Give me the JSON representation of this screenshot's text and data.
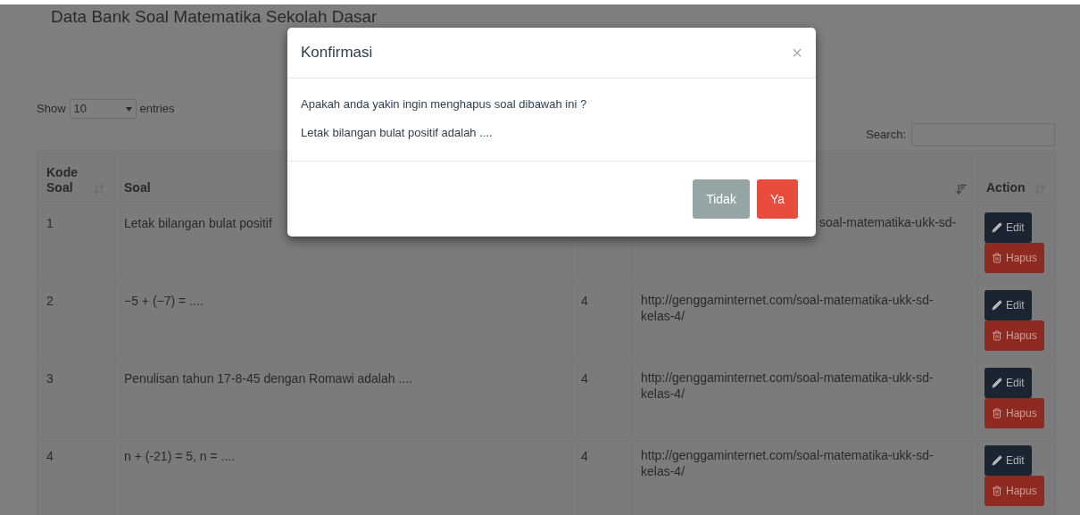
{
  "page_title": "Data Bank Soal Matematika Sekolah Dasar",
  "length_control": {
    "label_before": "Show",
    "value": "10",
    "label_after": "entries"
  },
  "search": {
    "label": "Search:"
  },
  "table": {
    "columns": [
      {
        "label": "Kode Soal",
        "sortable": true,
        "sorted": false
      },
      {
        "label": "Soal"
      },
      {},
      {
        "sortable": true,
        "sorted": true
      },
      {
        "label": "Action",
        "sortable": true,
        "sorted": false
      }
    ],
    "rows": [
      {
        "kode": "1",
        "soal": "Letak bilangan bulat positif",
        "column_4": "soal-matematika-ukk-sd-",
        "covered": true,
        "actions": [
          {
            "kind": "edit",
            "label": "Edit"
          },
          {
            "kind": "delete",
            "label": "Hapus"
          }
        ]
      },
      {
        "kode": "2",
        "soal": "−5 + (−7) = ....",
        "column_3": "4",
        "column_4": "http://genggaminternet.com/soal-matematika-ukk-sd-kelas-4/",
        "covered": false,
        "actions": [
          {
            "kind": "edit",
            "label": "Edit"
          },
          {
            "kind": "delete",
            "label": "Hapus"
          }
        ]
      },
      {
        "kode": "3",
        "soal": "Penulisan tahun 17-8-45 dengan Romawi adalah ....",
        "column_3": "4",
        "column_4": "http://genggaminternet.com/soal-matematika-ukk-sd-kelas-4/",
        "covered": false,
        "actions": [
          {
            "kind": "edit",
            "label": "Edit"
          },
          {
            "kind": "delete",
            "label": "Hapus"
          }
        ]
      },
      {
        "kode": "4",
        "soal": "n + (-21) = 5, n = ....",
        "column_3": "4",
        "column_4": "http://genggaminternet.com/soal-matematika-ukk-sd-kelas-4/",
        "covered": false,
        "actions": [
          {
            "kind": "edit",
            "label": "Edit"
          },
          {
            "kind": "delete",
            "label": "Hapus"
          }
        ]
      }
    ]
  },
  "modal": {
    "title": "Konfirmasi",
    "close": "×",
    "messages": [
      "Apakah anda yakin ingin menghapus soal dibawah ini ?",
      "Letak bilangan bulat positif adalah ...."
    ],
    "buttons": [
      {
        "kind": "cancel",
        "label": "Tidak"
      },
      {
        "kind": "confirm",
        "label": "Ya"
      }
    ]
  }
}
